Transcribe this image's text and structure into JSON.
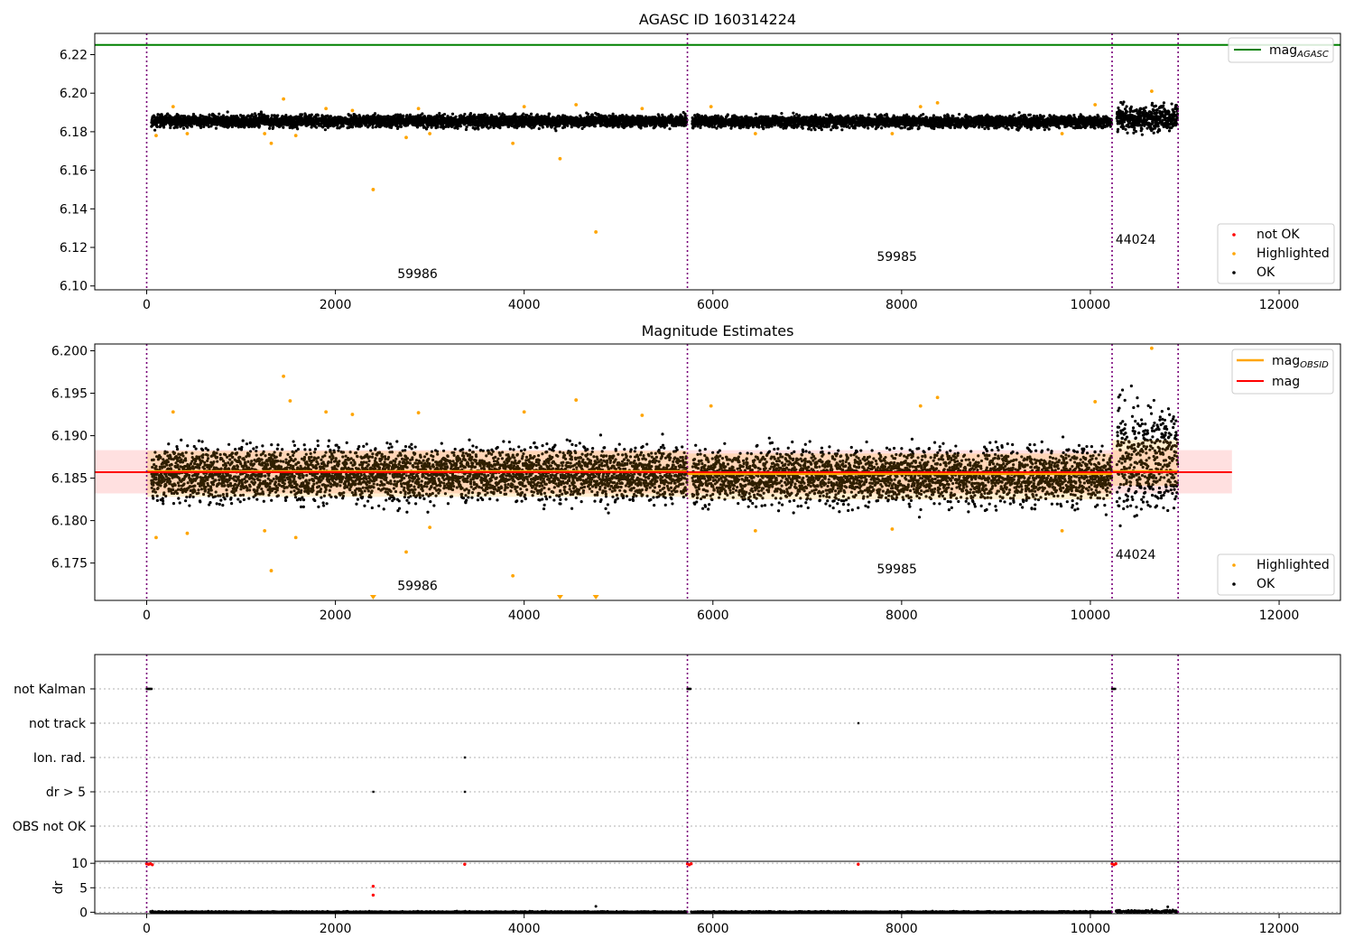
{
  "figure": {
    "title": "AGASC ID 160314224"
  },
  "chart_data": [
    {
      "type": "scatter",
      "title": "AGASC ID 160314224",
      "xlim": [
        -550,
        12650
      ],
      "ylim": [
        6.098,
        6.231
      ],
      "xticks": [
        0,
        2000,
        4000,
        6000,
        8000,
        10000,
        12000
      ],
      "xtick_labels": [
        "0",
        "2000",
        "4000",
        "6000",
        "8000",
        "10000",
        "12000"
      ],
      "yticks": [
        6.1,
        6.12,
        6.14,
        6.16,
        6.18,
        6.2,
        6.22
      ],
      "ytick_labels": [
        "6.10",
        "6.12",
        "6.14",
        "6.16",
        "6.18",
        "6.20",
        "6.22"
      ],
      "reference_line": {
        "name": "mag_AGASC",
        "value": 6.225,
        "color": "#008000",
        "x_range": [
          -550,
          12650
        ]
      },
      "obsid_boundaries": [
        0,
        5730,
        10230,
        10930
      ],
      "obsid_segments": [
        {
          "label": "59986",
          "x_start": 0,
          "x_end": 5730,
          "center": 6.1855,
          "spread": 0.0022
        },
        {
          "label": "59985",
          "x_start": 5730,
          "x_end": 10230,
          "center": 6.1852,
          "spread": 0.0022
        },
        {
          "label": "44024",
          "x_start": 10230,
          "x_end": 10930,
          "center": 6.1868,
          "spread": 0.0045
        }
      ],
      "obsid_label_positions": [
        {
          "label": "59986",
          "x": 2870,
          "y": 6.104
        },
        {
          "label": "59985",
          "x": 7950,
          "y": 6.113
        },
        {
          "label": "44024",
          "x": 10480,
          "y": 6.122
        }
      ],
      "highlighted_points": [
        [
          100,
          6.178
        ],
        [
          280,
          6.193
        ],
        [
          430,
          6.179
        ],
        [
          1250,
          6.179
        ],
        [
          1320,
          6.174
        ],
        [
          1450,
          6.197
        ],
        [
          1580,
          6.178
        ],
        [
          1900,
          6.192
        ],
        [
          2180,
          6.191
        ],
        [
          2400,
          6.15
        ],
        [
          2750,
          6.177
        ],
        [
          2880,
          6.192
        ],
        [
          3000,
          6.179
        ],
        [
          3880,
          6.174
        ],
        [
          4000,
          6.193
        ],
        [
          4380,
          6.166
        ],
        [
          4550,
          6.194
        ],
        [
          4760,
          6.128
        ],
        [
          5250,
          6.192
        ],
        [
          5980,
          6.193
        ],
        [
          6450,
          6.179
        ],
        [
          7900,
          6.179
        ],
        [
          8200,
          6.193
        ],
        [
          8380,
          6.195
        ],
        [
          9700,
          6.179
        ],
        [
          10050,
          6.194
        ],
        [
          10650,
          6.201
        ]
      ],
      "legend": [
        {
          "label": "not OK",
          "color": "#ff0000",
          "marker": "dot"
        },
        {
          "label": "Highlighted",
          "color": "#ffa500",
          "marker": "dot"
        },
        {
          "label": "OK",
          "color": "#000000",
          "marker": "dot"
        }
      ],
      "legend_top": {
        "label_main": "mag",
        "label_sub": "AGASC"
      },
      "legend_placement": "lower-right"
    },
    {
      "type": "scatter",
      "title": "Magnitude Estimates",
      "xlim": [
        -550,
        12650
      ],
      "ylim": [
        6.1706,
        6.2008
      ],
      "xticks": [
        0,
        2000,
        4000,
        6000,
        8000,
        10000,
        12000
      ],
      "xtick_labels": [
        "0",
        "2000",
        "4000",
        "6000",
        "8000",
        "10000",
        "12000"
      ],
      "yticks": [
        6.175,
        6.18,
        6.185,
        6.19,
        6.195,
        6.2
      ],
      "ytick_labels": [
        "6.175",
        "6.180",
        "6.185",
        "6.190",
        "6.195",
        "6.200"
      ],
      "mag_line": {
        "name": "mag",
        "value": 6.1857,
        "band": [
          6.1832,
          6.1883
        ],
        "x_range": [
          -550,
          11500
        ],
        "color": "#ff0000"
      },
      "obsid_mag_lines": [
        {
          "x_start": 0,
          "x_end": 5730,
          "value": 6.1858
        },
        {
          "x_start": 5730,
          "x_end": 10230,
          "value": 6.1855
        },
        {
          "x_start": 10230,
          "x_end": 10930,
          "value": 6.1858
        }
      ],
      "obsid_boundaries": [
        0,
        5730,
        10230,
        10930
      ],
      "obsid_segments": [
        {
          "label": "59986",
          "x_start": 0,
          "x_end": 5730,
          "center": 6.1855,
          "spread": 0.0022
        },
        {
          "label": "59985",
          "x_start": 5730,
          "x_end": 10230,
          "center": 6.1852,
          "spread": 0.0022
        },
        {
          "label": "44024",
          "x_start": 10230,
          "x_end": 10930,
          "center": 6.1868,
          "spread": 0.0045
        }
      ],
      "obsid_label_positions": [
        {
          "label": "59986",
          "x": 2870,
          "y": 6.1718
        },
        {
          "label": "59985",
          "x": 7950,
          "y": 6.1738
        },
        {
          "label": "44024",
          "x": 10480,
          "y": 6.1755
        }
      ],
      "highlighted_points": [
        [
          100,
          6.178
        ],
        [
          280,
          6.1928
        ],
        [
          430,
          6.1785
        ],
        [
          1250,
          6.1788
        ],
        [
          1320,
          6.1741
        ],
        [
          1450,
          6.197
        ],
        [
          1520,
          6.1941
        ],
        [
          1580,
          6.178
        ],
        [
          1900,
          6.1928
        ],
        [
          2180,
          6.1925
        ],
        [
          2750,
          6.1763
        ],
        [
          2880,
          6.1927
        ],
        [
          3000,
          6.1792
        ],
        [
          3880,
          6.1735
        ],
        [
          4000,
          6.1928
        ],
        [
          4550,
          6.1942
        ],
        [
          5250,
          6.1924
        ],
        [
          5980,
          6.1935
        ],
        [
          6450,
          6.1788
        ],
        [
          7900,
          6.179
        ],
        [
          8200,
          6.1935
        ],
        [
          8380,
          6.1945
        ],
        [
          9700,
          6.1788
        ],
        [
          10050,
          6.194
        ],
        [
          10650,
          6.2003
        ]
      ],
      "offscale_markers": [
        2400,
        4380,
        4760
      ],
      "legend": [
        {
          "label": "Highlighted",
          "color": "#ffa500",
          "marker": "dot"
        },
        {
          "label": "OK",
          "color": "#000000",
          "marker": "dot"
        }
      ],
      "legend_top": [
        {
          "label_main": "mag",
          "label_sub": "OBSID",
          "color": "#ffa500"
        },
        {
          "label_main": "mag",
          "label_sub": "",
          "color": "#ff0000"
        }
      ],
      "legend_placement": "lower-right"
    },
    {
      "type": "scatter",
      "title": "",
      "xlim": [
        -550,
        12650
      ],
      "flag_rows": [
        "not Kalman",
        "not track",
        "Ion. rad.",
        "dr > 5",
        "OBS not OK"
      ],
      "flag_points": {
        "not Kalman": [
          0,
          10,
          20,
          30,
          40,
          50,
          5730,
          5740,
          5750,
          5760,
          10230,
          10240,
          10250,
          10260
        ],
        "not track": [
          7540
        ],
        "Ion. rad.": [
          3370
        ],
        "dr > 5": [
          2400,
          3370
        ],
        "OBS not OK": []
      },
      "obsid_boundaries": [
        0,
        5730,
        10230,
        10930
      ]
    },
    {
      "type": "scatter",
      "title": "",
      "ylabel": "dr",
      "xlim": [
        -550,
        12650
      ],
      "ylim": [
        -0.3,
        10.4
      ],
      "xticks": [
        0,
        2000,
        4000,
        6000,
        8000,
        10000,
        12000
      ],
      "xtick_labels": [
        "0",
        "2000",
        "4000",
        "6000",
        "8000",
        "10000",
        "12000"
      ],
      "yticks": [
        0,
        5,
        10
      ],
      "ytick_labels": [
        "0",
        "5",
        "10"
      ],
      "flagged_points": [
        [
          0,
          9.9
        ],
        [
          20,
          9.8
        ],
        [
          40,
          9.9
        ],
        [
          60,
          9.7
        ],
        [
          2400,
          5.3
        ],
        [
          2400,
          3.5
        ],
        [
          3370,
          9.8
        ],
        [
          5730,
          9.9
        ],
        [
          5750,
          9.7
        ],
        [
          5770,
          9.9
        ],
        [
          7540,
          9.8
        ],
        [
          10230,
          9.9
        ],
        [
          10250,
          9.7
        ],
        [
          10270,
          9.9
        ]
      ],
      "outlier_points": [
        [
          4760,
          1.2
        ],
        [
          10820,
          1.1
        ]
      ],
      "obsid_boundaries": [
        0,
        5730,
        10230,
        10930
      ]
    }
  ],
  "colors": {
    "ok": "#000000",
    "highlighted": "#ffa500",
    "not_ok": "#ff0000",
    "agasc_line": "#008000",
    "mag_line": "#ff0000",
    "obsid_line": "#ffa500",
    "band": "#ff0000",
    "obsid_boundary": "#7a007a"
  }
}
